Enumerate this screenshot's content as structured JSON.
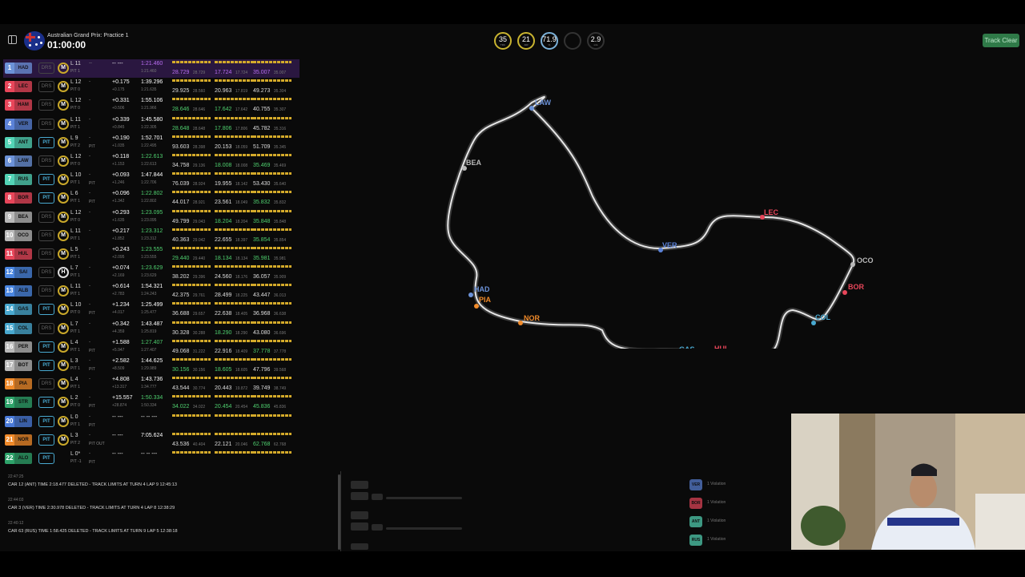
{
  "session": {
    "name": "Australian Grand Prix: Practice 1",
    "clock": "01:00:00"
  },
  "weather": [
    {
      "value": "35",
      "unit": "TRC",
      "ring": "#c9b430"
    },
    {
      "value": "21",
      "unit": "AIR",
      "ring": "#c9b430"
    },
    {
      "value": "71.9",
      "unit": "%",
      "ring": "#7ab0d8"
    },
    {
      "value": "",
      "unit": "",
      "ring": "#333"
    },
    {
      "value": "2.9",
      "unit": "m/s",
      "ring": "#333"
    }
  ],
  "track_status": "Track Clear",
  "drivers": [
    {
      "pos": "1",
      "tla": "HAD",
      "color": "#6c92d8",
      "drs": "DRS",
      "tyre": "M",
      "lap": "L 11",
      "pit": "PIT 1",
      "dash": "--",
      "pitstat": "",
      "gap": "-- ---",
      "gap2": "",
      "time": "1:21.460",
      "time2": "1:21.460",
      "s1": "28.729",
      "s1b": "28.729",
      "s2": "17.724",
      "s2b": "17.724",
      "s3": "35.007",
      "s3b": "35.007",
      "fast": true
    },
    {
      "pos": "2",
      "tla": "LEC",
      "color": "#e8465a",
      "drs": "DRS",
      "tyre": "M",
      "lap": "L 12",
      "pit": "PIT 0",
      "dash": "-",
      "pitstat": "",
      "gap": "+0.175",
      "gap2": "+0.175",
      "time": "1:39.296",
      "time2": "1:21.635",
      "s1": "29.925",
      "s1b": "28.560",
      "s2": "20.963",
      "s2b": "17.819",
      "s3": "49.273",
      "s3b": "35.304"
    },
    {
      "pos": "3",
      "tla": "HAM",
      "color": "#e8465a",
      "drs": "DRS",
      "tyre": "M",
      "lap": "L 12",
      "pit": "PIT 0",
      "dash": "-",
      "pitstat": "",
      "gap": "+0.331",
      "gap2": "+0.506",
      "time": "1:55.106",
      "time2": "1:21.966",
      "s1": "28.646",
      "s1b": "28.646",
      "s2": "17.642",
      "s2b": "17.642",
      "s3": "40.755",
      "s3b": "35.307"
    },
    {
      "pos": "4",
      "tla": "VER",
      "color": "#5b82d8",
      "drs": "DRS",
      "tyre": "M",
      "lap": "L 11",
      "pit": "PIT 1",
      "dash": "-",
      "pitstat": "",
      "gap": "+0.339",
      "gap2": "+0.845",
      "time": "1:45.580",
      "time2": "1:22.305",
      "s1": "28.648",
      "s1b": "28.648",
      "s2": "17.806",
      "s2b": "17.806",
      "s3": "45.782",
      "s3b": "35.316"
    },
    {
      "pos": "5",
      "tla": "ANT",
      "color": "#53d4b6",
      "drs": "PIT",
      "tyre": "M",
      "lap": "L 9",
      "pit": "PIT 2",
      "dash": "-",
      "pitstat": "PIT",
      "gap": "+0.190",
      "gap2": "+1.035",
      "time": "1:52.701",
      "time2": "1:22.495",
      "s1": "93.603",
      "s1b": "28.398",
      "s2": "20.153",
      "s2b": "18.059",
      "s3": "51.709",
      "s3b": "35.345"
    },
    {
      "pos": "6",
      "tla": "LAW",
      "color": "#6c92d8",
      "drs": "DRS",
      "tyre": "M",
      "lap": "L 12",
      "pit": "PIT 0",
      "dash": "-",
      "pitstat": "",
      "gap": "+0.118",
      "gap2": "+1.153",
      "time": "1:22.613",
      "time2": "1:22.613",
      "s1": "34.758",
      "s1b": "29.136",
      "s2": "18.008",
      "s2b": "18.008",
      "s3": "35.469",
      "s3b": "35.469"
    },
    {
      "pos": "7",
      "tla": "RUS",
      "color": "#53d4b6",
      "drs": "PIT",
      "tyre": "M",
      "lap": "L 10",
      "pit": "PIT 1",
      "dash": "-",
      "pitstat": "PIT",
      "gap": "+0.093",
      "gap2": "+1.246",
      "time": "1:47.844",
      "time2": "1:22.706",
      "s1": "76.039",
      "s1b": "28.924",
      "s2": "19.955",
      "s2b": "18.142",
      "s3": "53.430",
      "s3b": "35.640"
    },
    {
      "pos": "8",
      "tla": "BOR",
      "color": "#e8465a",
      "drs": "PIT",
      "tyre": "M",
      "lap": "L 6",
      "pit": "PIT 1",
      "dash": "-",
      "pitstat": "PIT",
      "gap": "+0.096",
      "gap2": "+1.342",
      "time": "1:22.802",
      "time2": "1:22.802",
      "s1": "44.017",
      "s1b": "28.921",
      "s2": "23.561",
      "s2b": "18.049",
      "s3": "35.832",
      "s3b": "35.832"
    },
    {
      "pos": "9",
      "tla": "BEA",
      "color": "#b9b9b9",
      "drs": "DRS",
      "tyre": "M",
      "lap": "L 12",
      "pit": "PIT 0",
      "dash": "-",
      "pitstat": "",
      "gap": "+0.293",
      "gap2": "+1.635",
      "time": "1:23.095",
      "time2": "1:23.095",
      "s1": "49.799",
      "s1b": "29.043",
      "s2": "18.204",
      "s2b": "18.204",
      "s3": "35.848",
      "s3b": "35.848"
    },
    {
      "pos": "10",
      "tla": "OCO",
      "color": "#b9b9b9",
      "drs": "DRS",
      "tyre": "M",
      "lap": "L 11",
      "pit": "PIT 1",
      "dash": "-",
      "pitstat": "",
      "gap": "+0.217",
      "gap2": "+1.852",
      "time": "1:23.312",
      "time2": "1:23.312",
      "s1": "40.363",
      "s1b": "29.042",
      "s2": "22.655",
      "s2b": "18.397",
      "s3": "35.854",
      "s3b": "35.854"
    },
    {
      "pos": "11",
      "tla": "HUL",
      "color": "#e8465a",
      "drs": "DRS",
      "tyre": "M",
      "lap": "L 5",
      "pit": "PIT 1",
      "dash": "-",
      "pitstat": "",
      "gap": "+0.243",
      "gap2": "+2.095",
      "time": "1:23.555",
      "time2": "1:23.555",
      "s1": "29.440",
      "s1b": "29.440",
      "s2": "18.134",
      "s2b": "18.134",
      "s3": "35.981",
      "s3b": "35.981"
    },
    {
      "pos": "12",
      "tla": "SAI",
      "color": "#4a86e0",
      "drs": "DRS",
      "tyre": "H",
      "lap": "L 7",
      "pit": "PIT 1",
      "dash": "-",
      "pitstat": "",
      "gap": "+0.074",
      "gap2": "+2.169",
      "time": "1:23.629",
      "time2": "1:23.629",
      "s1": "38.202",
      "s1b": "29.396",
      "s2": "24.560",
      "s2b": "18.176",
      "s3": "36.057",
      "s3b": "35.909"
    },
    {
      "pos": "13",
      "tla": "ALB",
      "color": "#4a86e0",
      "drs": "DRS",
      "tyre": "M",
      "lap": "L 11",
      "pit": "PIT 1",
      "dash": "-",
      "pitstat": "",
      "gap": "+0.614",
      "gap2": "+2.783",
      "time": "1:54.321",
      "time2": "1:24.243",
      "s1": "42.375",
      "s1b": "29.761",
      "s2": "28.499",
      "s2b": "18.225",
      "s3": "43.447",
      "s3b": "36.013"
    },
    {
      "pos": "14",
      "tla": "GAS",
      "color": "#49a9d0",
      "drs": "PIT",
      "tyre": "M",
      "lap": "L 10",
      "pit": "PIT 0",
      "dash": "-",
      "pitstat": "PIT",
      "gap": "+1.234",
      "gap2": "+4.017",
      "time": "1:25.499",
      "time2": "1:25.477",
      "s1": "36.688",
      "s1b": "29.657",
      "s2": "22.638",
      "s2b": "18.405",
      "s3": "36.968",
      "s3b": "36.638"
    },
    {
      "pos": "15",
      "tla": "COL",
      "color": "#49a9d0",
      "drs": "DRS",
      "tyre": "M",
      "lap": "L 7",
      "pit": "PIT 1",
      "dash": "-",
      "pitstat": "",
      "gap": "+0.342",
      "gap2": "+4.359",
      "time": "1:43.487",
      "time2": "1:25.819",
      "s1": "30.328",
      "s1b": "30.288",
      "s2": "18.290",
      "s2b": "18.290",
      "s3": "43.080",
      "s3b": "36.696"
    },
    {
      "pos": "16",
      "tla": "PER",
      "color": "#b9b9b9",
      "drs": "PIT",
      "tyre": "M",
      "lap": "L 4",
      "pit": "PIT 1",
      "dash": "-",
      "pitstat": "PIT",
      "gap": "+1.588",
      "gap2": "+5.947",
      "time": "1:27.407",
      "time2": "1:27.407",
      "s1": "49.068",
      "s1b": "31.222",
      "s2": "22.916",
      "s2b": "18.409",
      "s3": "37.778",
      "s3b": "37.778"
    },
    {
      "pos": "17",
      "tla": "BOT",
      "color": "#b9b9b9",
      "drs": "PIT",
      "tyre": "M",
      "lap": "L 3",
      "pit": "PIT 1",
      "dash": "-",
      "pitstat": "PIT",
      "gap": "+2.582",
      "gap2": "+8.509",
      "time": "1:44.625",
      "time2": "1:29.989",
      "s1": "30.156",
      "s1b": "30.156",
      "s2": "18.605",
      "s2b": "18.605",
      "s3": "47.796",
      "s3b": "39.568"
    },
    {
      "pos": "18",
      "tla": "PIA",
      "color": "#f08a2a",
      "drs": "DRS",
      "tyre": "M",
      "lap": "L 4",
      "pit": "PIT 1",
      "dash": "-",
      "pitstat": "",
      "gap": "+4.808",
      "gap2": "+13.317",
      "time": "1:43.736",
      "time2": "1:34.777",
      "s1": "43.544",
      "s1b": "30.774",
      "s2": "20.443",
      "s2b": "19.872",
      "s3": "39.749",
      "s3b": "38.749"
    },
    {
      "pos": "19",
      "tla": "STR",
      "color": "#2ea36a",
      "drs": "PIT",
      "tyre": "M",
      "lap": "L 2",
      "pit": "PIT 0",
      "dash": "-",
      "pitstat": "PIT",
      "gap": "+15.557",
      "gap2": "+28.874",
      "time": "1:50.334",
      "time2": "1:50.334",
      "s1": "34.022",
      "s1b": "34.022",
      "s2": "20.454",
      "s2b": "20.454",
      "s3": "45.836",
      "s3b": "45.836"
    },
    {
      "pos": "20",
      "tla": "LIN",
      "color": "#4a7ad8",
      "drs": "PIT",
      "tyre": "M",
      "lap": "L 0",
      "pit": "PIT 1",
      "dash": "-",
      "pitstat": "PIT",
      "gap": "-- ---",
      "gap2": "",
      "time": "-- -- ---",
      "time2": "",
      "s1": "",
      "s1b": "",
      "s2": "",
      "s2b": "",
      "s3": "",
      "s3b": ""
    },
    {
      "pos": "21",
      "tla": "NOR",
      "color": "#f08a2a",
      "drs": "PIT",
      "tyre": "M",
      "lap": "L 3",
      "pit": "PIT 2",
      "dash": "-",
      "pitstat": "PIT OUT",
      "gap": "-- ---",
      "gap2": "",
      "time": "7:05.624",
      "time2": "",
      "s1": "43.536",
      "s1b": "40.404",
      "s2": "22.121",
      "s2b": "20.046",
      "s3": "62.768",
      "s3b": "62.768"
    },
    {
      "pos": "22",
      "tla": "ALO",
      "color": "#2ea36a",
      "drs": "PIT",
      "tyre": "",
      "lap": "L 0*",
      "pit": "PIT -1",
      "dash": "-",
      "pitstat": "PIT",
      "gap": "-- ---",
      "gap2": "",
      "time": "-- -- ---",
      "time2": "",
      "s1": "",
      "s1b": "",
      "s2": "",
      "s2b": "",
      "s3": "",
      "s3b": ""
    }
  ],
  "map_drivers": [
    {
      "tla": "LAW",
      "color": "#6c92d8",
      "dot": "#6c92d8"
    },
    {
      "tla": "BEA",
      "color": "#b9b9b9",
      "dot": "#b9b9b9"
    },
    {
      "tla": "LEC",
      "color": "#e8465a",
      "dot": "#e8465a"
    },
    {
      "tla": "VER",
      "color": "#5b82d8",
      "dot": "#5b82d8"
    },
    {
      "tla": "OCO",
      "color": "#b9b9b9",
      "dot": "#b9b9b9"
    },
    {
      "tla": "BOR",
      "color": "#e8465a",
      "dot": "#e8465a"
    },
    {
      "tla": "HAD",
      "color": "#6c92d8",
      "dot": "#6c92d8"
    },
    {
      "tla": "PIA",
      "color": "#f08a2a",
      "dot": "#f08a2a"
    },
    {
      "tla": "NOR",
      "color": "#f08a2a",
      "dot": "#f08a2a"
    },
    {
      "tla": "COL",
      "color": "#49a9d0",
      "dot": "#49a9d0"
    },
    {
      "tla": "HUL",
      "color": "#e8465a",
      "dot": "#e8465a"
    },
    {
      "tla": "GAS",
      "color": "#49a9d0",
      "dot": "#49a9d0"
    }
  ],
  "race_control": [
    {
      "time": "22:47:25",
      "msg": "CAR 12 (ANT) TIME 2:18.477 DELETED - TRACK LIMITS AT TURN 4 LAP 9 12:45:13"
    },
    {
      "time": "22:44:03",
      "msg": "CAR 3 (VER) TIME 2:30.978 DELETED - TRACK LIMITS AT TURN 4 LAP 8 12:38:29"
    },
    {
      "time": "22:40:12",
      "msg": "CAR 63 (RUS) TIME 1:58.425 DELETED - TRACK LIMITS AT TURN 9 LAP 5 12:38:18"
    }
  ],
  "violations": [
    {
      "tla": "VER",
      "color": "#5b82d8",
      "text": "1 Violation"
    },
    {
      "tla": "BOR",
      "color": "#e8465a",
      "text": "1 Violation"
    },
    {
      "tla": "ANT",
      "color": "#53d4b6",
      "text": "1 Violation"
    },
    {
      "tla": "RUS",
      "color": "#53d4b6",
      "text": "1 Violation"
    }
  ]
}
